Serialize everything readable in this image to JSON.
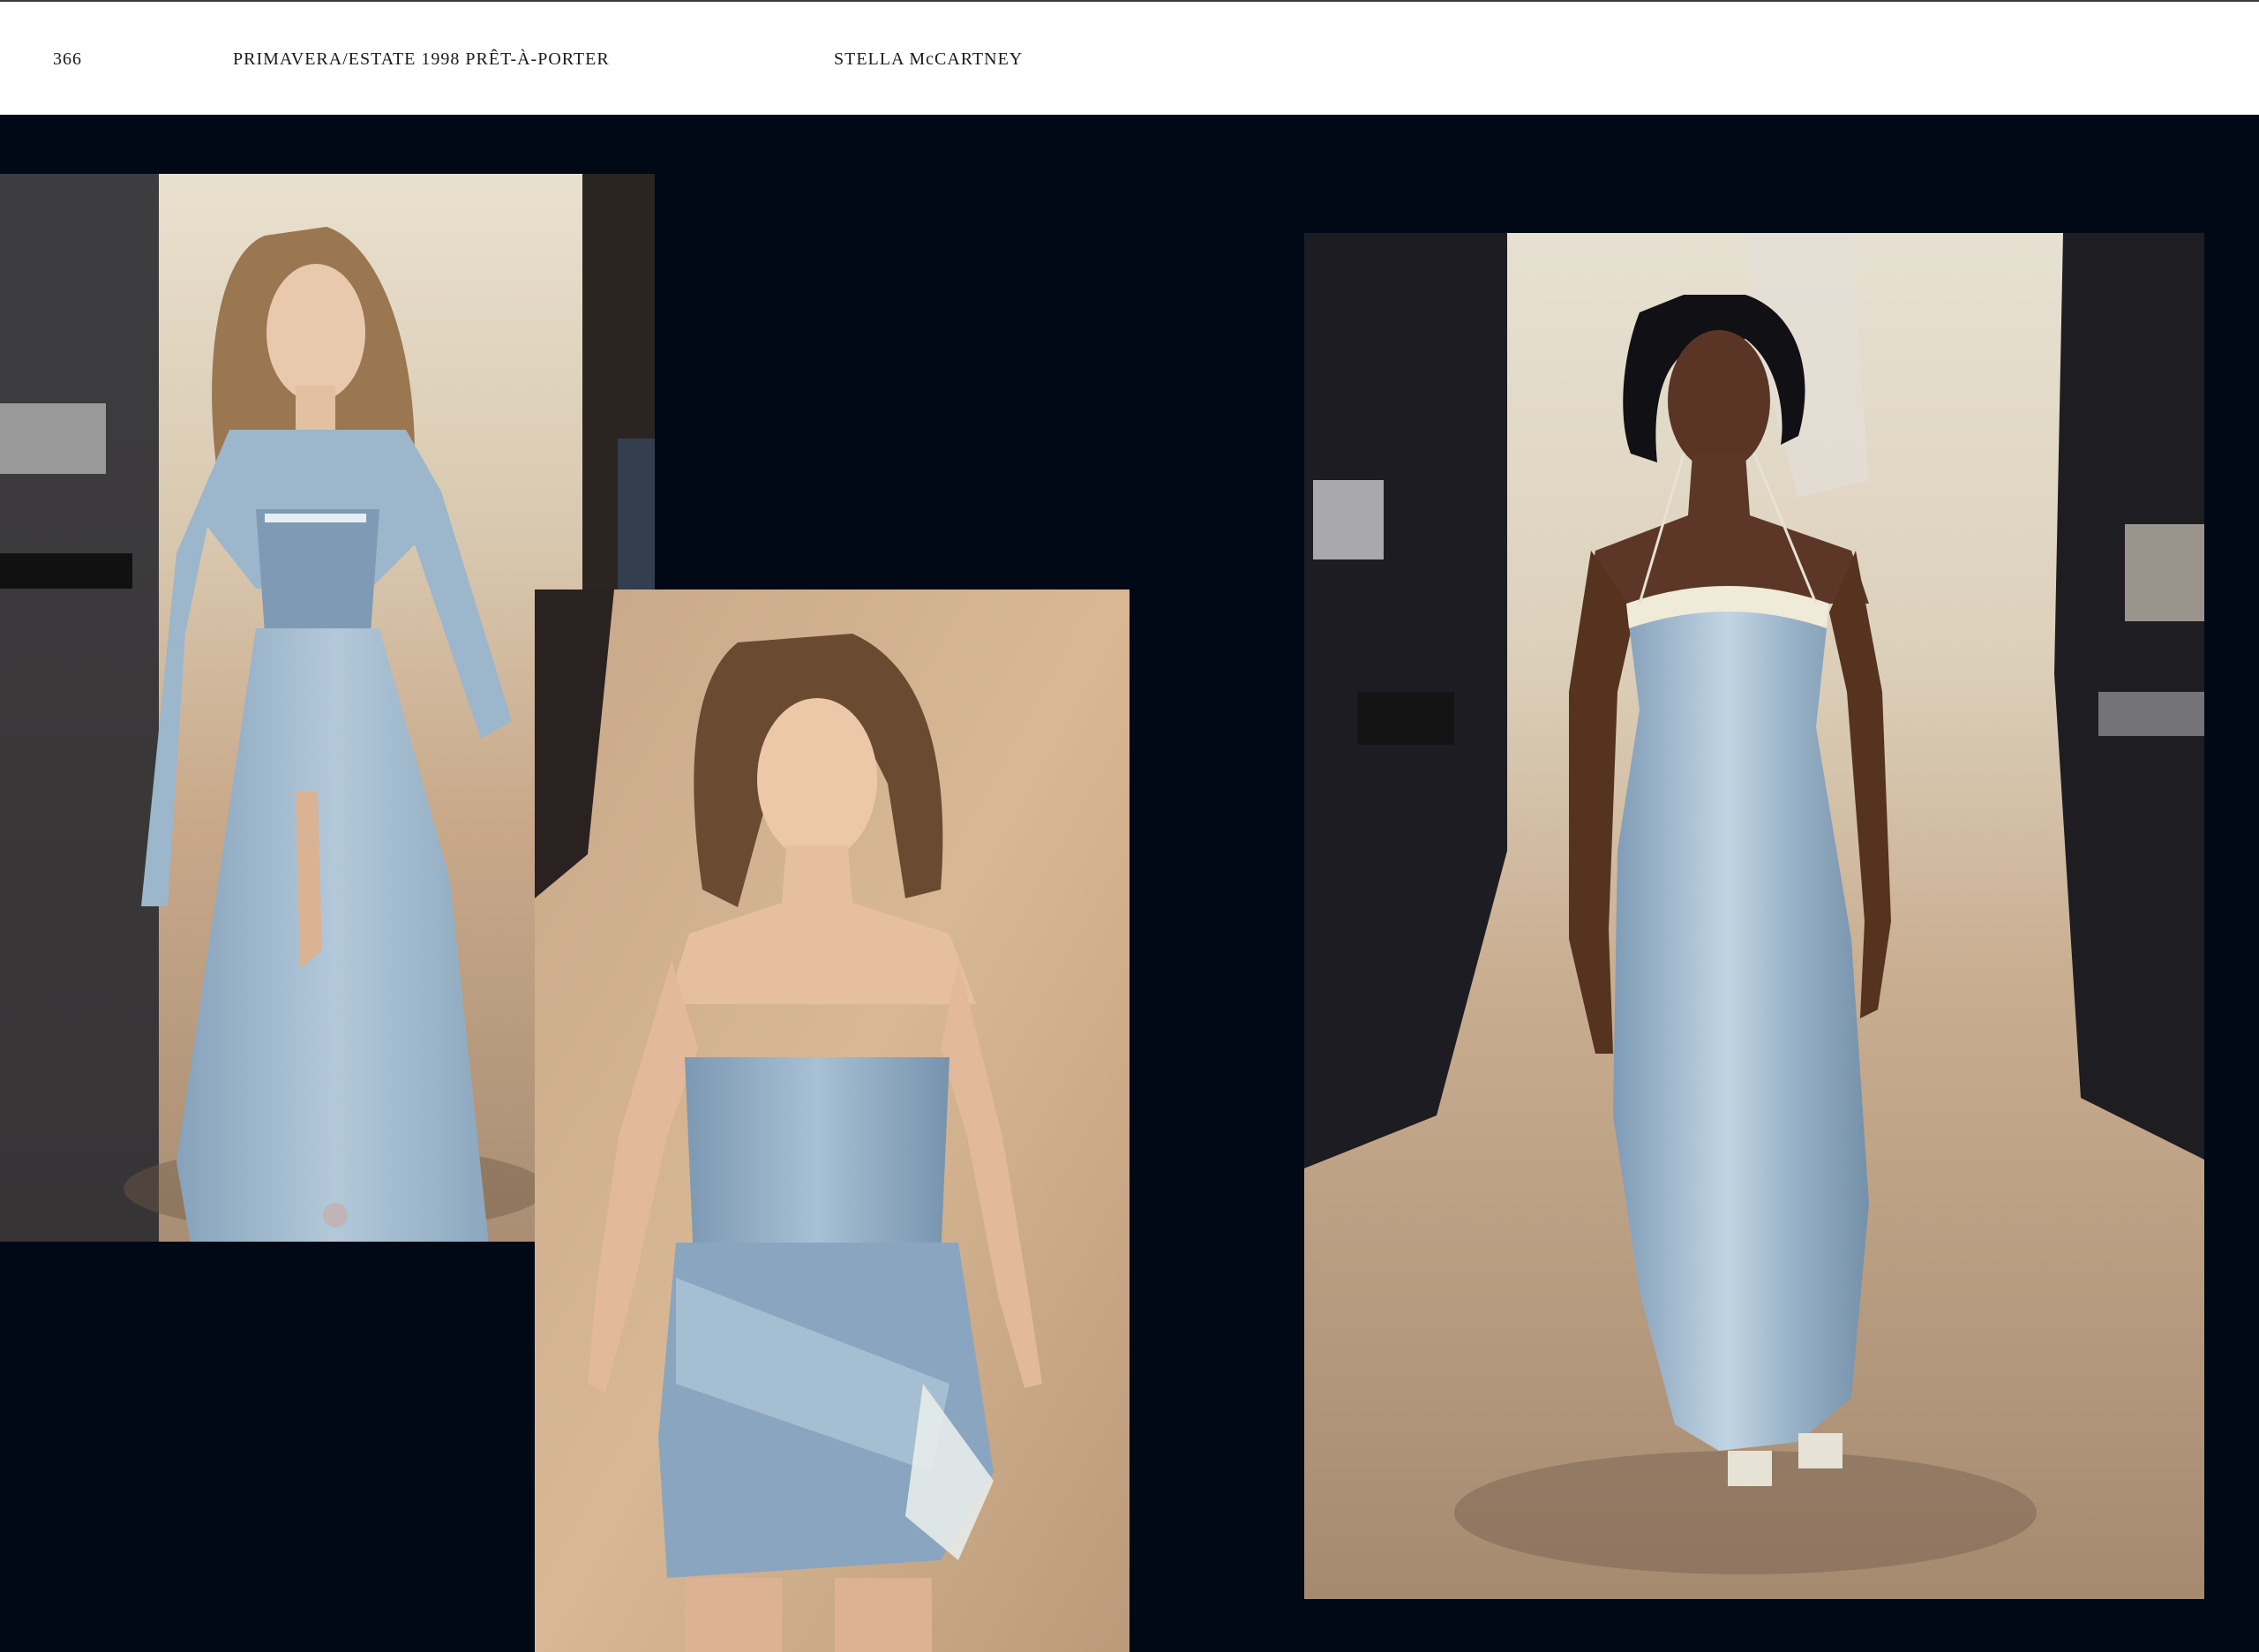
{
  "header": {
    "page_number": "366",
    "section": "PRIMAVERA/ESTATE  1998  PRÊT-À-PORTER",
    "designer": "STELLA McCARTNEY"
  },
  "colors": {
    "background": "#010916",
    "header_bg": "#ffffff",
    "header_text": "#1a1a1a",
    "dress_blue": "#9db6cc",
    "runway_floor": "#c6a98a"
  },
  "photos": [
    {
      "name": "runway-look-corset-gown",
      "icon": "runway-photo"
    },
    {
      "name": "runway-look-satin-minidress",
      "icon": "runway-photo"
    },
    {
      "name": "runway-look-slip-gown",
      "icon": "runway-photo"
    }
  ]
}
